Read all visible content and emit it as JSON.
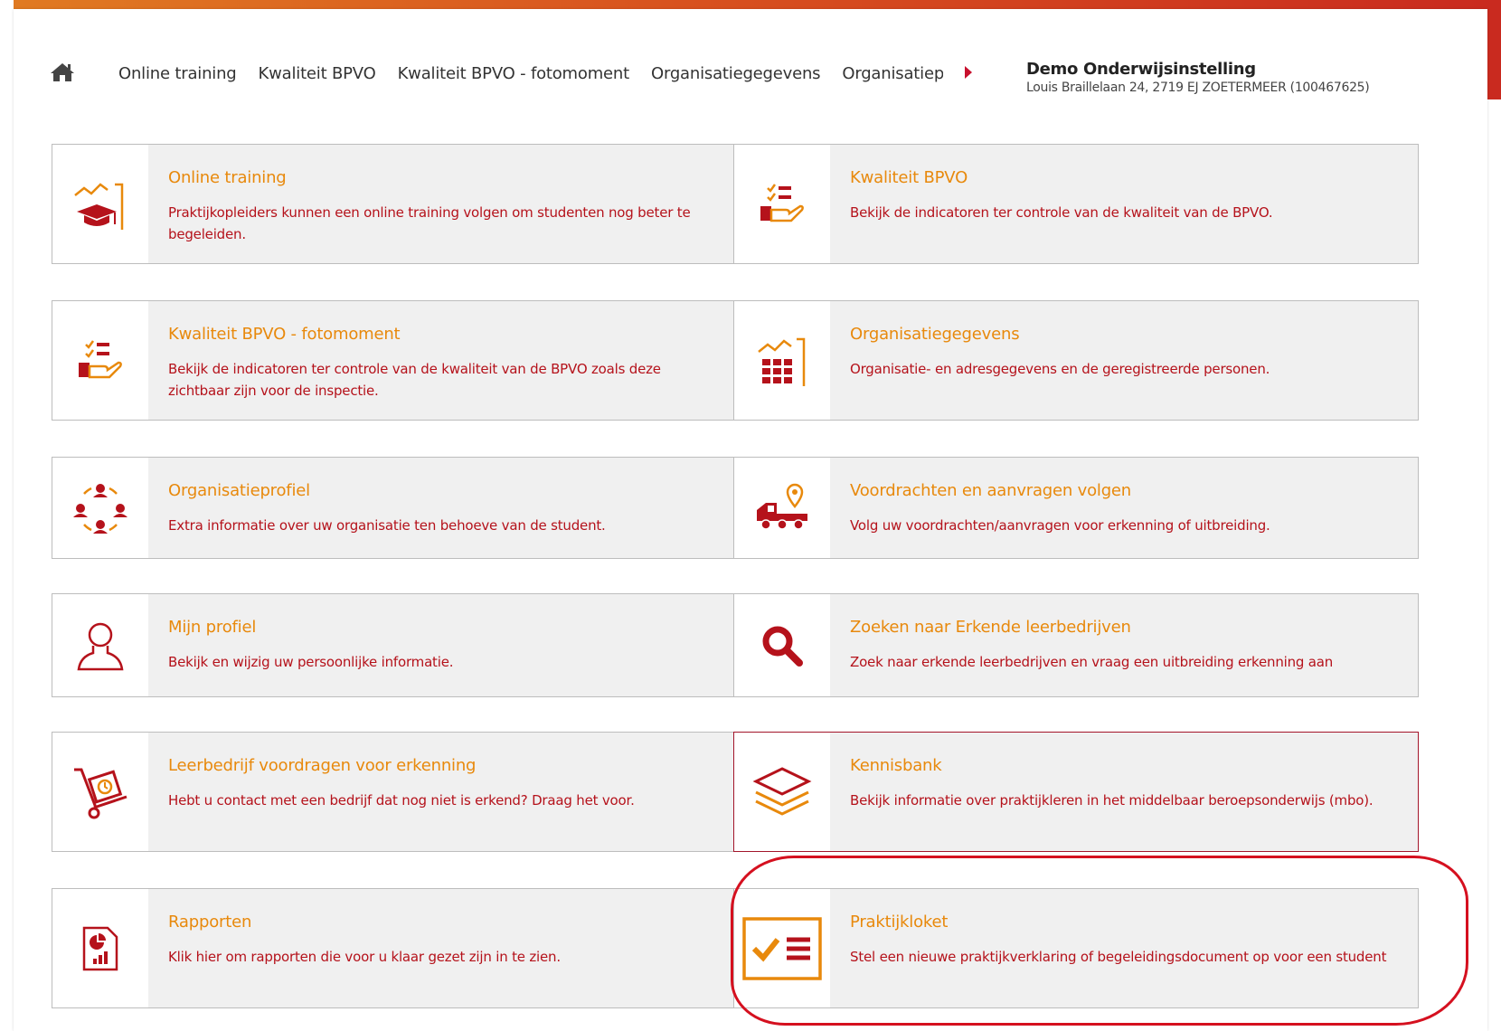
{
  "colors": {
    "brand_orange": "#e8890c",
    "brand_red": "#b5121b",
    "highlight": "#d5101f"
  },
  "nav": {
    "home_icon": "home-icon",
    "breadcrumbs": [
      "Online training",
      "Kwaliteit BPVO",
      "Kwaliteit BPVO - fotomoment",
      "Organisatiegegevens",
      "Organisatiep"
    ],
    "organization": {
      "name": "Demo Onderwijsinstelling",
      "address": "Louis Braillelaan 24, 2719 EJ ZOETERMEER (100467625)"
    }
  },
  "tiles": [
    {
      "icon": "chart-graduation-cap-icon",
      "title": "Online training",
      "description": "Praktijkopleiders kunnen een online training volgen om studenten nog beter te begeleiden."
    },
    {
      "icon": "checklist-hand-icon",
      "title": "Kwaliteit BPVO",
      "description": "Bekijk de indicatoren ter controle van de kwaliteit van de BPVO."
    },
    {
      "icon": "checklist-hand-icon",
      "title": "Kwaliteit BPVO - fotomoment",
      "description": "Bekijk de indicatoren ter controle van de kwaliteit van de BPVO zoals deze zichtbaar zijn voor de inspectie."
    },
    {
      "icon": "chart-building-icon",
      "title": "Organisatiegegevens",
      "description": "Organisatie- en adresgegevens en de geregistreerde personen."
    },
    {
      "icon": "people-circle-icon",
      "title": "Organisatieprofiel",
      "description": "Extra informatie over uw organisatie ten behoeve van de student."
    },
    {
      "icon": "truck-location-icon",
      "title": "Voordrachten en aanvragen volgen",
      "description": "Volg uw voordrachten/aanvragen voor erkenning of uitbreiding."
    },
    {
      "icon": "user-outline-icon",
      "title": "Mijn profiel",
      "description": "Bekijk en wijzig uw persoonlijke informatie."
    },
    {
      "icon": "search-icon",
      "title": "Zoeken naar Erkende leerbedrijven",
      "description": "Zoek naar erkende leerbedrijven en vraag een uitbreiding erkenning aan"
    },
    {
      "icon": "hand-truck-icon",
      "title": "Leerbedrijf voordragen voor erkenning",
      "description": "Hebt u contact met een bedrijf dat nog niet is erkend? Draag het voor."
    },
    {
      "icon": "layers-icon",
      "title": "Kennisbank",
      "description": "Bekijk informatie over praktijkleren in het middelbaar beroepsonderwijs (mbo)."
    },
    {
      "icon": "report-icon",
      "title": "Rapporten",
      "description": "Klik hier om rapporten die voor u klaar gezet zijn in te zien."
    },
    {
      "icon": "checked-list-icon",
      "title": "Praktijkloket",
      "description": "Stel een nieuwe praktijkverklaring of begeleidingsdocument op voor een student"
    }
  ]
}
